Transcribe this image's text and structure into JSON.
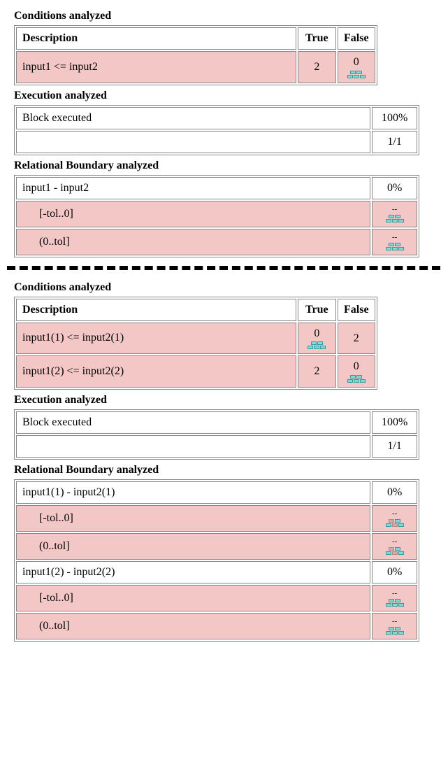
{
  "top": {
    "cond_title": "Conditions analyzed",
    "cond_header_desc": "Description",
    "cond_header_true": "True",
    "cond_header_false": "False",
    "cond_rows": [
      {
        "desc": "input1 <= input2",
        "true": "2",
        "true_icon": "",
        "false": "0",
        "false_icon": "bricks"
      }
    ],
    "exec_title": "Execution analyzed",
    "exec_label": "Block executed",
    "exec_pct": "100%",
    "exec_ratio": "1/1",
    "rel_title": "Relational Boundary analyzed",
    "rel_header": "input1 - input2",
    "rel_pct": "0%",
    "rel_rows": [
      {
        "range": "[-tol..0]",
        "val": "--",
        "icon": "bricks"
      },
      {
        "range": "(0..tol]",
        "val": "--",
        "icon": "bricks"
      }
    ]
  },
  "bottom": {
    "cond_title": "Conditions analyzed",
    "cond_header_desc": "Description",
    "cond_header_true": "True",
    "cond_header_false": "False",
    "cond_rows": [
      {
        "desc": "input1(1) <= input2(1)",
        "true": "0",
        "true_icon": "bricks",
        "false": "2",
        "false_icon": ""
      },
      {
        "desc": "input1(2) <= input2(2)",
        "true": "2",
        "true_icon": "",
        "false": "0",
        "false_icon": "bricks"
      }
    ],
    "exec_title": "Execution analyzed",
    "exec_label": "Block executed",
    "exec_pct": "100%",
    "exec_ratio": "1/1",
    "rel_title": "Relational Boundary analyzed",
    "rel_groups": [
      {
        "header": "input1(1) - input2(1)",
        "pct": "0%",
        "rows": [
          {
            "range": "[-tol..0]",
            "val": "--",
            "icon": "bricks-muted"
          },
          {
            "range": "(0..tol]",
            "val": "--",
            "icon": "bricks-muted"
          }
        ]
      },
      {
        "header": "input1(2) - input2(2)",
        "pct": "0%",
        "rows": [
          {
            "range": "[-tol..0]",
            "val": "--",
            "icon": "bricks"
          },
          {
            "range": "(0..tol]",
            "val": "--",
            "icon": "bricks"
          }
        ]
      }
    ]
  }
}
